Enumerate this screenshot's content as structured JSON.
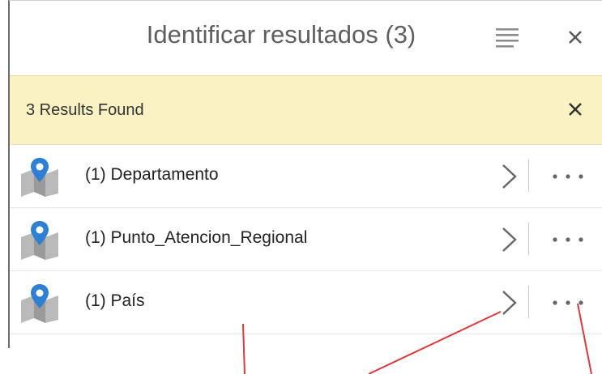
{
  "header": {
    "title": "Identificar resultados (3)",
    "menu_icon": "hamburger-menu-icon",
    "close_icon": "close-icon"
  },
  "banner": {
    "text": "3 Results Found",
    "close_icon": "close-icon"
  },
  "results": [
    {
      "label": "(1) Departamento",
      "icon": "map-pin-icon"
    },
    {
      "label": "(1) Punto_Atencion_Regional",
      "icon": "map-pin-icon"
    },
    {
      "label": "(1) País",
      "icon": "map-pin-icon"
    }
  ],
  "colors": {
    "banner_bg": "#faf2c3",
    "pin_blue": "#2f7fd2",
    "annotation_red": "#d93b3b"
  }
}
